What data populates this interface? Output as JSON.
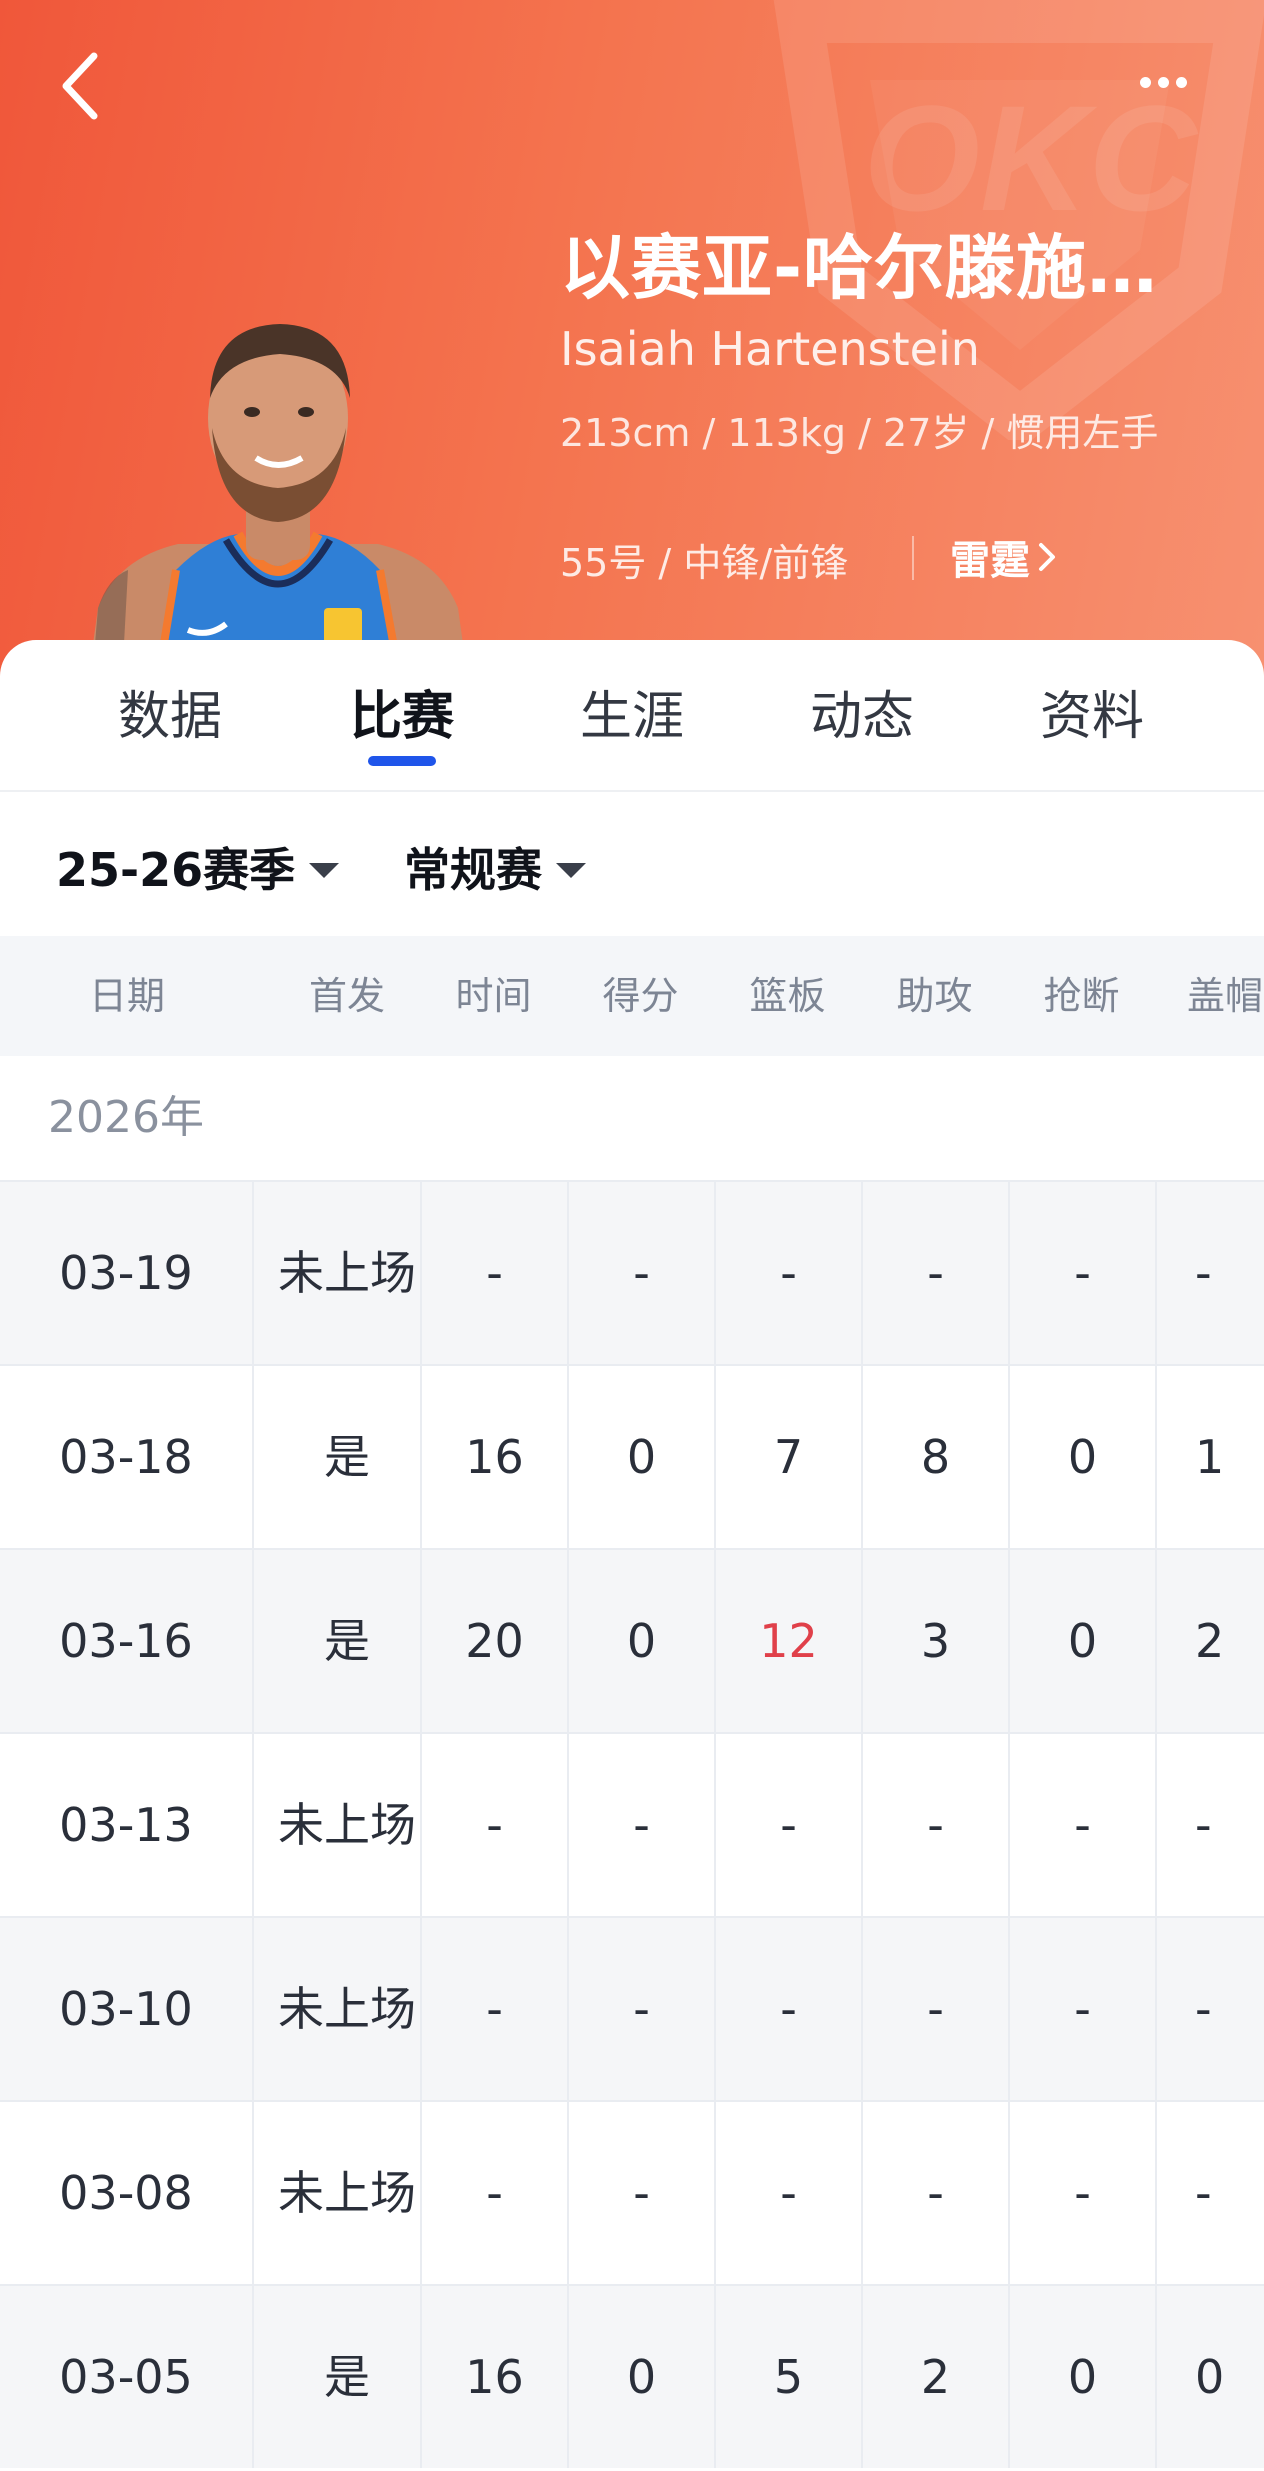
{
  "header": {
    "name_cn": "以赛亚-哈尔滕施…",
    "name_en": "Isaiah Hartenstein",
    "bio": "213cm / 113kg / 27岁 / 惯用左手",
    "position": "55号 / 中锋/前锋",
    "team": "雷霆",
    "logo_text": "OKC"
  },
  "tabs": [
    "数据",
    "比赛",
    "生涯",
    "动态",
    "资料"
  ],
  "active_tab": "比赛",
  "filters": {
    "season": "25-26赛季",
    "type": "常规赛"
  },
  "table": {
    "columns": [
      "日期",
      "首发",
      "时间",
      "得分",
      "篮板",
      "助攻",
      "抢断",
      "盖帽"
    ],
    "year": "2026年",
    "rows": [
      {
        "date": "03-19",
        "starter": "未上场",
        "time": "-",
        "points": "-",
        "rebounds": "-",
        "assists": "-",
        "steals": "-",
        "blocks": "-"
      },
      {
        "date": "03-18",
        "starter": "是",
        "time": "16",
        "points": "0",
        "rebounds": "7",
        "assists": "8",
        "steals": "0",
        "blocks": "1"
      },
      {
        "date": "03-16",
        "starter": "是",
        "time": "20",
        "points": "0",
        "rebounds": "12",
        "assists": "3",
        "steals": "0",
        "blocks": "2"
      },
      {
        "date": "03-13",
        "starter": "未上场",
        "time": "-",
        "points": "-",
        "rebounds": "-",
        "assists": "-",
        "steals": "-",
        "blocks": "-"
      },
      {
        "date": "03-10",
        "starter": "未上场",
        "time": "-",
        "points": "-",
        "rebounds": "-",
        "assists": "-",
        "steals": "-",
        "blocks": "-"
      },
      {
        "date": "03-08",
        "starter": "未上场",
        "time": "-",
        "points": "-",
        "rebounds": "-",
        "assists": "-",
        "steals": "-",
        "blocks": "-"
      },
      {
        "date": "03-05",
        "starter": "是",
        "time": "16",
        "points": "0",
        "rebounds": "5",
        "assists": "2",
        "steals": "0",
        "blocks": "0"
      }
    ],
    "highlight_color": "#e0404a"
  },
  "colors": {
    "header_start": "#f0573a",
    "header_end": "#f79070",
    "tab_indicator": "#1f55ea",
    "table_header_bg": "#f4f6f9"
  },
  "icons": {
    "back": "chevron-left-icon",
    "more": "more-horizontal-icon",
    "team_arrow": "chevron-right-icon",
    "dropdown": "caret-down-icon"
  }
}
